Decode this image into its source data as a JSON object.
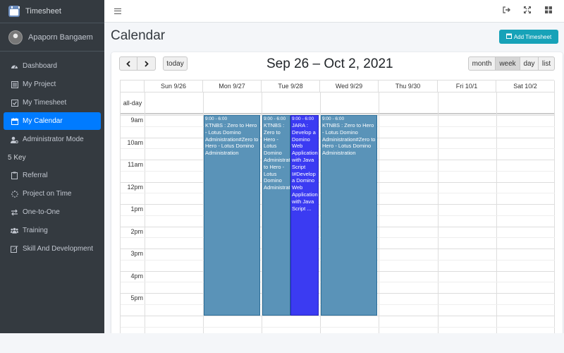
{
  "app": {
    "title": "Timesheet"
  },
  "user": {
    "name": "Apaporn Bangaem"
  },
  "sidebar": {
    "items": [
      {
        "label": "Dashboard",
        "icon": "tachometer-icon"
      },
      {
        "label": "My Project",
        "icon": "list-icon"
      },
      {
        "label": "My Timesheet",
        "icon": "check-square-icon"
      },
      {
        "label": "My Calendar",
        "icon": "calendar-icon",
        "active": true
      },
      {
        "label": "Administrator Mode",
        "icon": "user-cog-icon"
      }
    ],
    "section_header": "5 Key",
    "key_items": [
      {
        "label": "Referral",
        "icon": "clipboard-icon"
      },
      {
        "label": "Project on Time",
        "icon": "spinner-icon"
      },
      {
        "label": "One-to-One",
        "icon": "exchange-icon"
      },
      {
        "label": "Training",
        "icon": "users-icon"
      },
      {
        "label": "Skill And Development",
        "icon": "edit-icon"
      }
    ]
  },
  "topbar": {
    "icons": [
      "sign-out-icon",
      "expand-icon",
      "grid-icon"
    ]
  },
  "page": {
    "title": "Calendar",
    "add_button": "Add Timesheet"
  },
  "calendar": {
    "prev": "‹",
    "next": "›",
    "today": "today",
    "title": "Sep 26 – Oct 2, 2021",
    "views": {
      "month": "month",
      "week": "week",
      "day": "day",
      "list": "list"
    },
    "active_view": "week",
    "days": [
      "Sun 9/26",
      "Mon 9/27",
      "Tue 9/28",
      "Wed 9/29",
      "Thu 9/30",
      "Fri 10/1",
      "Sat 10/2"
    ],
    "allday_label": "all-day",
    "times": [
      "9am",
      "10am",
      "11am",
      "12pm",
      "1pm",
      "2pm",
      "3pm",
      "4pm",
      "5pm"
    ],
    "events": [
      {
        "day": "Mon 9/27",
        "time": "9:00 - 6:00",
        "title": "KTNBS : Zero to Hero - Lotus Domino Administration#Zero to Hero - Lotus Domino Administration",
        "color": "#5a93b8"
      },
      {
        "day": "Tue 9/28",
        "time": "9:00 - 6:00",
        "title": "KTNBS : Zero to Hero - Lotus Domino Administration#Zero to Hero - Lotus Domino Administration",
        "color": "#5a93b8"
      },
      {
        "day": "Tue 9/28",
        "time": "9:00 - 6:00",
        "title": "JARA : Develop a Domino Web Application with Java Script I#Develop a Domino Web Application with Java Script ...",
        "color": "#3b3bf2"
      },
      {
        "day": "Wed 9/29",
        "time": "9:00 - 6:00",
        "title": "KTNBS : Zero to Hero - Lotus Domino Administration#Zero to Hero - Lotus Domino Administration",
        "color": "#5a93b8"
      }
    ]
  }
}
